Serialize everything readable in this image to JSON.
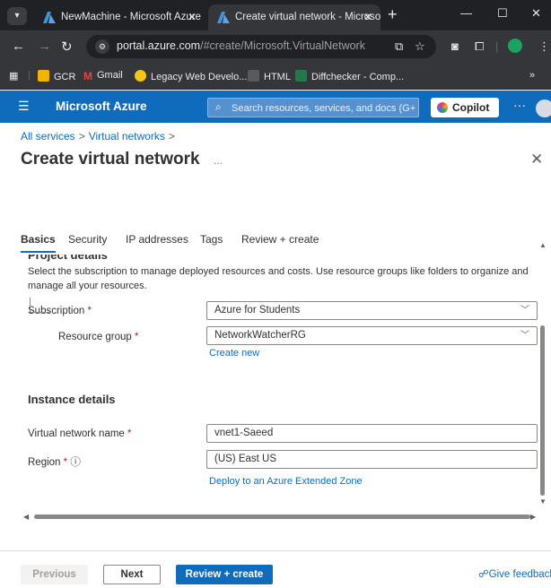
{
  "browser": {
    "tabs": [
      {
        "title": "NewMachine - Microsoft Azure",
        "close": "✕",
        "active": false
      },
      {
        "title": "Create virtual network - Microso",
        "close": "✕",
        "active": true
      }
    ],
    "new_tab": "+",
    "window_controls": {
      "minimize": "—",
      "maximize": "☐",
      "close": "✕"
    },
    "address": {
      "host": "portal.azure.com",
      "path": "/#create/Microsoft.VirtualNetwork"
    },
    "bookmarks": [
      {
        "label": "GCR",
        "color": "#f2b400"
      },
      {
        "label": "Gmail",
        "color": "#ea4335"
      },
      {
        "label": "Legacy Web Develo...",
        "color": "#f5c518"
      },
      {
        "label": "HTML",
        "color": "#5a5a5a"
      },
      {
        "label": "Diffchecker - Comp...",
        "color": "#1f7a4c"
      }
    ],
    "bookmarks_more": "»"
  },
  "azure_header": {
    "brand": "Microsoft Azure",
    "search_placeholder": "Search resources, services, and docs (G+/)",
    "copilot_label": "Copilot",
    "more": "···"
  },
  "breadcrumb": {
    "items": [
      "All services",
      "Virtual networks"
    ],
    "sep": ">"
  },
  "page": {
    "title": "Create virtual network",
    "more": "...",
    "close": "✕"
  },
  "tabs": [
    "Basics",
    "Security",
    "IP addresses",
    "Tags",
    "Review + create"
  ],
  "project_details": {
    "heading": "Project details",
    "description": "Select the subscription to manage deployed resources and costs. Use resource groups like folders to organize and manage all your resources.",
    "subscription_label": "Subscription",
    "subscription_value": "Azure for Students",
    "resource_group_label": "Resource group",
    "resource_group_value": "NetworkWatcherRG",
    "create_new": "Create new",
    "required_mark": "*"
  },
  "instance_details": {
    "heading": "Instance details",
    "vnet_name_label": "Virtual network name",
    "vnet_name_value": "vnet1-Saeed",
    "region_label": "Region",
    "region_value": "(US) East US",
    "info_icon": "ⓘ",
    "extended_zone_link": "Deploy to an Azure Extended Zone"
  },
  "footer": {
    "previous": "Previous",
    "next": "Next",
    "review_create": "Review + create",
    "feedback": "Give feedback"
  }
}
